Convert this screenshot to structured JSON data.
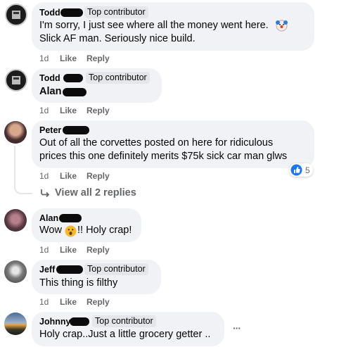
{
  "comments": [
    {
      "name": "Todd",
      "badge": "Top contributor",
      "line1": "I'm sorry, I just see where all the money went here.",
      "line2": "Slick AF man. Seriously nice build.",
      "time": "1d",
      "like": "Like",
      "reply": "Reply"
    },
    {
      "name": "Todd",
      "badge": "Top contributor",
      "line1": "Alan",
      "time": "1d",
      "like": "Like",
      "reply": "Reply"
    },
    {
      "name": "Peter",
      "line1": "Out of all the corvettes posted on here for ridiculous",
      "line2": "prices this one definitely merits $75k sick car man glws",
      "time": "1d",
      "like": "Like",
      "reply": "Reply",
      "reaction_count": "5"
    },
    {
      "name": "Alan",
      "line1": "Wow",
      "line1b": "!! Holy crap!",
      "time": "1d",
      "like": "Like",
      "reply": "Reply"
    },
    {
      "name": "Jeff",
      "badge": "Top contributor",
      "line1": "This thing is filthy",
      "time": "1d",
      "like": "Like",
      "reply": "Reply"
    },
    {
      "name": "Johnny",
      "badge": "Top contributor",
      "line1": "Holy crap..Just a little grocery getter .."
    }
  ],
  "view_replies": "View all 2 replies",
  "more_menu": "···",
  "colors": {
    "bubble": "#f0f2f5",
    "meta": "#65676b",
    "like_blue": "#1877f2",
    "badge_bg": "#e4e6eb"
  }
}
